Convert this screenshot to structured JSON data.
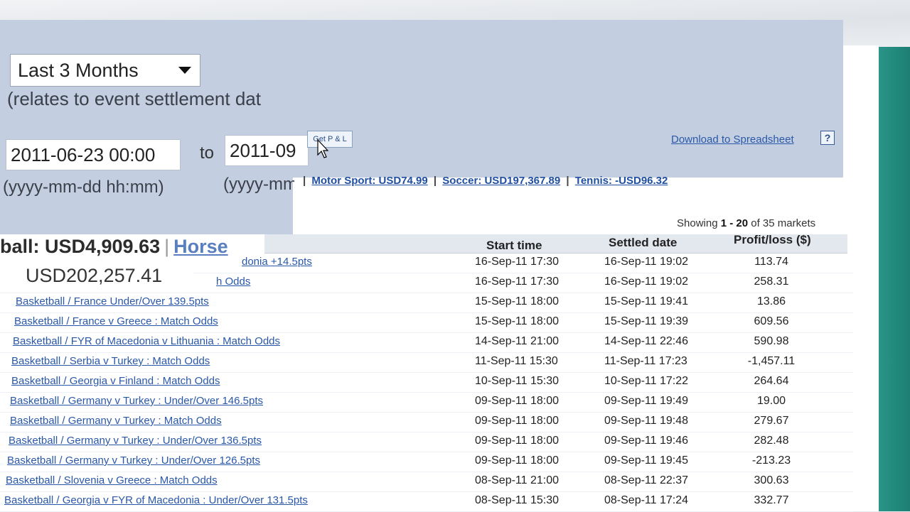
{
  "filters": {
    "period": "Last 3 Months",
    "settlement_note": "(relates to event settlement dat",
    "from_value": "2011-06-23 00:00",
    "to_label": "to",
    "to_value": "2011-09",
    "from_format": "(yyyy-mm-dd hh:mm)",
    "to_format": "(yyyy-mm",
    "pl_button": "Get P & L"
  },
  "download": {
    "label": "Download to Spreadsheet",
    "help": "?"
  },
  "sport_totals": [
    {
      "label": "Motor Sport: USD74.99"
    },
    {
      "label": "Soccer: USD197,367.89"
    },
    {
      "label": "Tennis: -USD96.32"
    }
  ],
  "showing": {
    "prefix": "Showing",
    "range": "1 - 20",
    "suffix": "of 35 markets"
  },
  "section": {
    "title": "ball: USD4,909.63",
    "separator": "|",
    "horse_link": "Horse",
    "overlay_total": "USD202,257.41"
  },
  "table": {
    "headers": {
      "start": "Start time",
      "settled": "Settled date",
      "pl": "Profit/loss ($)"
    },
    "rows": [
      {
        "market": "donia +14.5pts",
        "start": "16-Sep-11 17:30",
        "settled": "16-Sep-11 19:02",
        "pl": "113.74"
      },
      {
        "market": "h Odds",
        "start": "16-Sep-11 17:30",
        "settled": "16-Sep-11 19:02",
        "pl": "258.31"
      },
      {
        "market": "Basketball / France  Under/Over 139.5pts",
        "start": "15-Sep-11 18:00",
        "settled": "15-Sep-11 19:41",
        "pl": "13.86"
      },
      {
        "market": "Basketball / France v Greece : Match Odds",
        "start": "15-Sep-11 18:00",
        "settled": "15-Sep-11 19:39",
        "pl": "609.56"
      },
      {
        "market": "Basketball / FYR of Macedonia v Lithuania : Match Odds",
        "start": "14-Sep-11 21:00",
        "settled": "14-Sep-11 22:46",
        "pl": "590.98"
      },
      {
        "market": "Basketball / Serbia v Turkey : Match Odds",
        "start": "11-Sep-11 15:30",
        "settled": "11-Sep-11 17:23",
        "pl": "-1,457.11"
      },
      {
        "market": "Basketball / Georgia v Finland : Match Odds",
        "start": "10-Sep-11 15:30",
        "settled": "10-Sep-11 17:22",
        "pl": "264.64"
      },
      {
        "market": "Basketball / Germany v Turkey : Under/Over 146.5pts",
        "start": "09-Sep-11 18:00",
        "settled": "09-Sep-11 19:49",
        "pl": "19.00"
      },
      {
        "market": "Basketball / Germany v Turkey : Match Odds",
        "start": "09-Sep-11 18:00",
        "settled": "09-Sep-11 19:48",
        "pl": "279.67"
      },
      {
        "market": "Basketball / Germany v Turkey : Under/Over 136.5pts",
        "start": "09-Sep-11 18:00",
        "settled": "09-Sep-11 19:46",
        "pl": "282.48"
      },
      {
        "market": "Basketball / Germany v Turkey : Under/Over 126.5pts",
        "start": "09-Sep-11 18:00",
        "settled": "09-Sep-11 19:45",
        "pl": "-213.23"
      },
      {
        "market": "Basketball / Slovenia v Greece : Match Odds",
        "start": "08-Sep-11 21:00",
        "settled": "08-Sep-11 22:37",
        "pl": "300.63"
      },
      {
        "market": "Basketball / Georgia v FYR of Macedonia : Under/Over 131.5pts",
        "start": "08-Sep-11 15:30",
        "settled": "08-Sep-11 17:24",
        "pl": "332.77"
      }
    ]
  }
}
